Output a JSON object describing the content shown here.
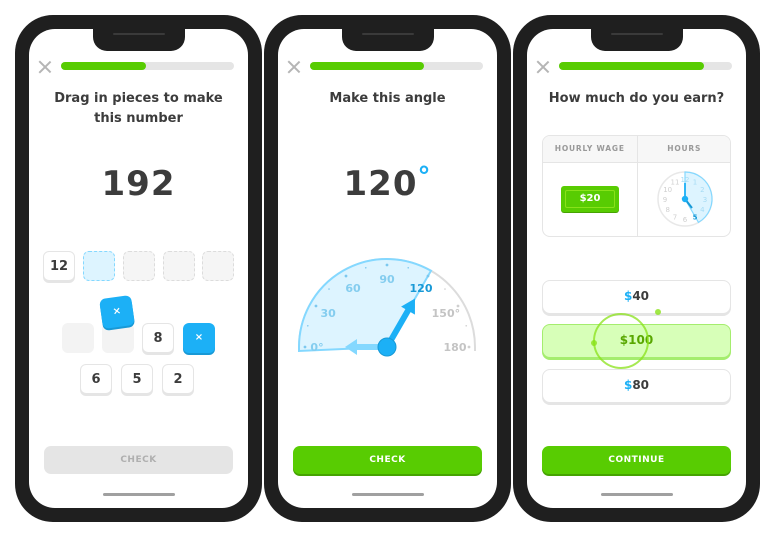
{
  "screens": [
    {
      "progress": 0.49,
      "close_icon": "close-icon",
      "title": "Drag in pieces to make this number",
      "target_number": "192",
      "answer_slots": [
        {
          "value": "12",
          "state": "filled"
        },
        {
          "value": "",
          "state": "active"
        },
        {
          "value": "",
          "state": "empty"
        },
        {
          "value": "",
          "state": "empty"
        },
        {
          "value": "",
          "state": "empty"
        }
      ],
      "piece_bank": {
        "row1": [
          {
            "value": "",
            "kind": "ghost"
          },
          {
            "value": "",
            "kind": "ghost"
          },
          {
            "value": "8",
            "kind": "number"
          },
          {
            "value": "×",
            "kind": "operator"
          }
        ],
        "dragging": {
          "value": "×",
          "kind": "operator"
        },
        "row2": [
          {
            "value": "6",
            "kind": "number"
          },
          {
            "value": "5",
            "kind": "number"
          },
          {
            "value": "2",
            "kind": "number"
          }
        ]
      },
      "button": {
        "label": "CHECK",
        "state": "disabled"
      }
    },
    {
      "progress": 0.66,
      "title": "Make this angle",
      "target_angle": "120",
      "degree_symbol": "°",
      "gauge": {
        "labels": [
          {
            "text": "0°",
            "angle": 0
          },
          {
            "text": "30",
            "angle": 30
          },
          {
            "text": "60",
            "angle": 60
          },
          {
            "text": "90",
            "angle": 90
          },
          {
            "text": "120",
            "angle": 120
          },
          {
            "text": "150°",
            "angle": 150
          },
          {
            "text": "180",
            "angle": 180
          }
        ],
        "current_angle": 120,
        "range": [
          0,
          180
        ]
      },
      "button": {
        "label": "CHECK",
        "state": "enabled"
      }
    },
    {
      "progress": 0.84,
      "title": "How much do you earn?",
      "table": {
        "headers": [
          "HOURLY WAGE",
          "HOURS"
        ],
        "wage": "$20",
        "hours_clock": {
          "numbers": [
            "12",
            "1",
            "2",
            "3",
            "4",
            "5",
            "6",
            "7",
            "8",
            "9",
            "10",
            "11"
          ],
          "shaded_until": 5
        }
      },
      "answers": [
        {
          "currency": "$",
          "amount": "40",
          "selected": false
        },
        {
          "currency": "$",
          "amount": "100",
          "selected": true
        },
        {
          "currency": "$",
          "amount": "80",
          "selected": false
        }
      ],
      "button": {
        "label": "CONTINUE",
        "state": "enabled"
      }
    }
  ],
  "colors": {
    "brand_green": "#58cc02",
    "accent_blue": "#1cb0f6",
    "text_dark": "#3c3c3c",
    "disabled_gray": "#e5e5e5"
  }
}
